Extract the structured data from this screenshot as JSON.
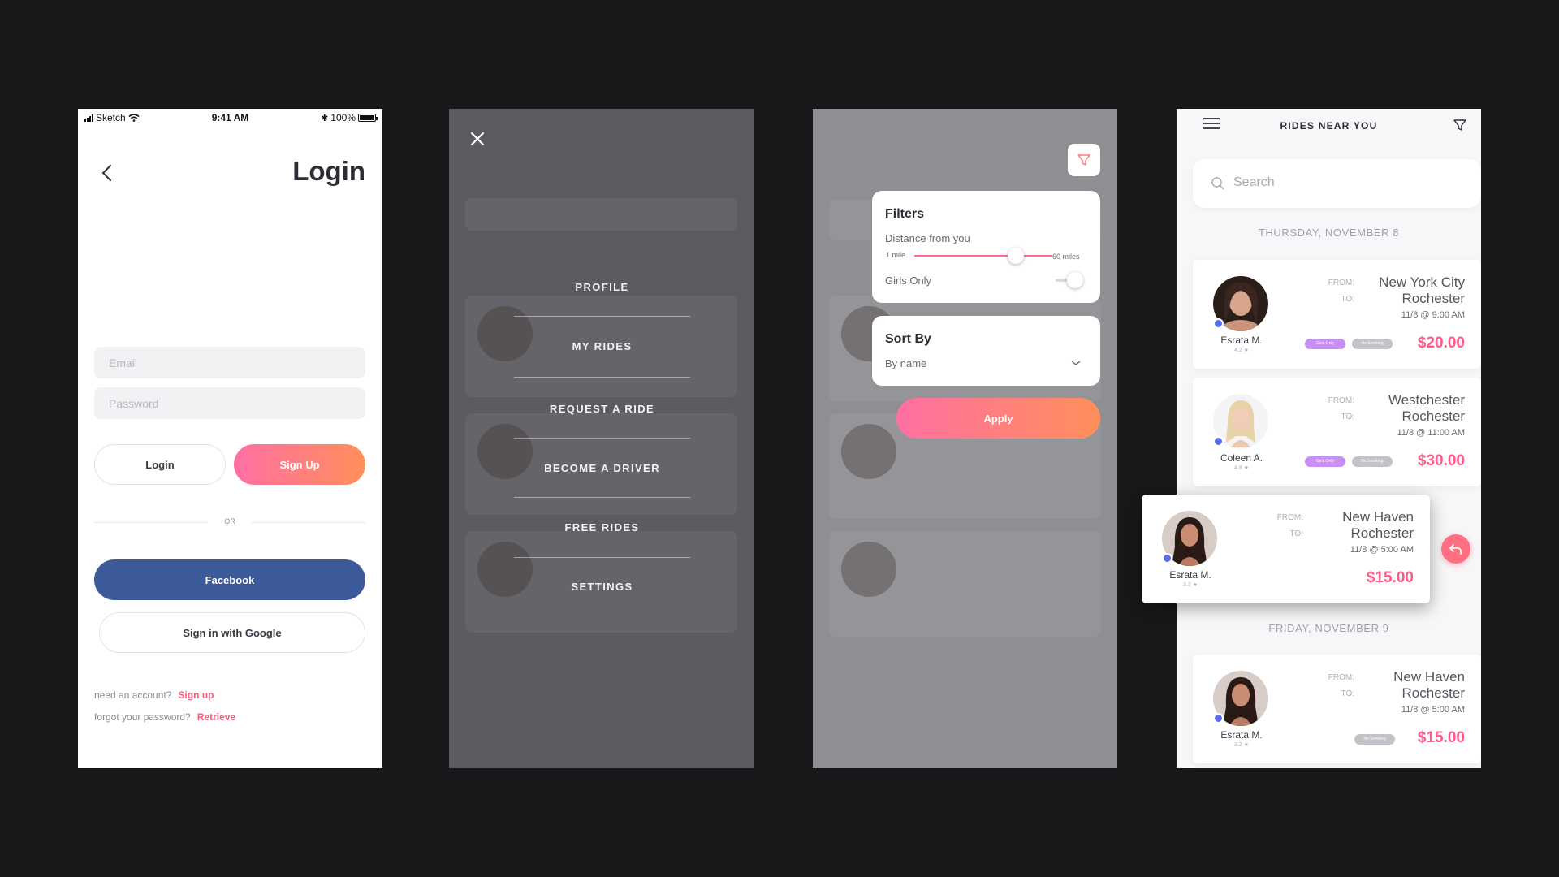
{
  "login_screen": {
    "status": {
      "carrier": "Sketch",
      "time": "9:41 AM",
      "battery": "100%"
    },
    "title": "Login",
    "email_placeholder": "Email",
    "password_placeholder": "Password",
    "login_label": "Login",
    "signup_label": "Sign Up",
    "or_label": "OR",
    "facebook_label": "Facebook",
    "google_label": "Sign in with Google",
    "need_account_text": "need an account?",
    "signup_link": "Sign up",
    "forgot_text": "forgot your password?",
    "retrieve_link": "Retrieve",
    "colors": {
      "primary_gradient": [
        "#ff6fa3",
        "#ff8f5a"
      ],
      "facebook": "#3c5a9a",
      "link": "#ff5a7a"
    }
  },
  "menu_screen": {
    "items": [
      "PROFILE",
      "MY RIDES",
      "REQUEST A RIDE",
      "BECOME A DRIVER",
      "FREE RIDES",
      "SETTINGS"
    ],
    "icon": "close-icon"
  },
  "filter_screen": {
    "filters_title": "Filters",
    "distance_label": "Distance from you",
    "min_label": "1 mile",
    "max_label": "60 miles",
    "distance_value_fraction": 0.84,
    "girls_only_label": "Girls Only",
    "girls_only_on": true,
    "sort_title": "Sort By",
    "sort_value": "By name",
    "apply_label": "Apply"
  },
  "rides_screen": {
    "title": "RIDES NEAR YOU",
    "search_placeholder": "Search",
    "date_1": "THURSDAY, NOVEMBER 8",
    "date_2": "FRIDAY, NOVEMBER 9",
    "from_label": "FROM:",
    "to_label": "TO:",
    "tags": {
      "girls": "Girls Only",
      "nosmoke": "No Smoking"
    },
    "rides": [
      {
        "name": "Esrata M.",
        "rating": "4.2 ★",
        "from": "New York City",
        "to": "Rochester",
        "when": "11/8 @ 9:00 AM",
        "price": "$20.00"
      },
      {
        "name": "Coleen A.",
        "rating": "4.8 ★",
        "from": "Westchester",
        "to": "Rochester",
        "when": "11/8 @ 11:00 AM",
        "price": "$30.00"
      },
      {
        "name": "Esrata M.",
        "rating": "3.2 ★",
        "from": "New Haven",
        "to": "Rochester",
        "when": "11/8 @ 5:00 AM",
        "price": "$15.00"
      },
      {
        "name": "Esrata M.",
        "rating": "3.2 ★",
        "from": "New Haven",
        "to": "Rochester",
        "when": "11/8 @ 5:00 AM",
        "price": "$15.00"
      }
    ],
    "accent": "#ff5a8a"
  }
}
